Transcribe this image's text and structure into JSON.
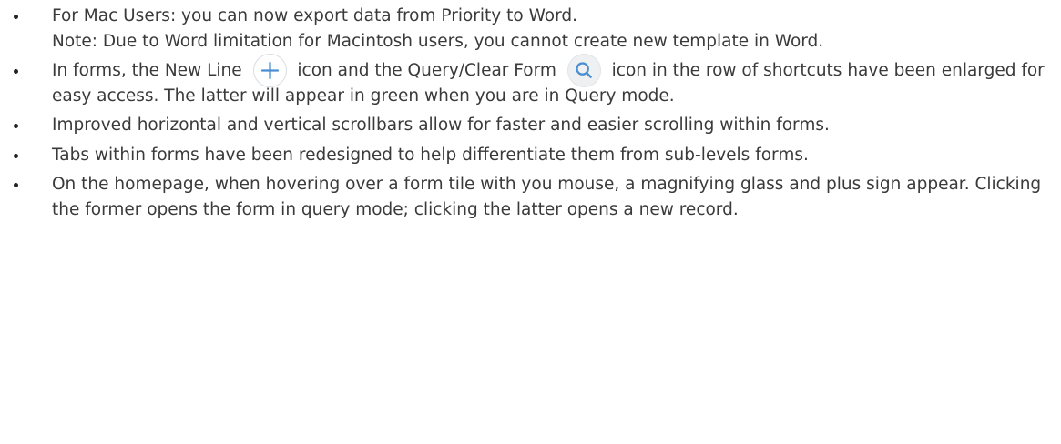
{
  "bullets": [
    {
      "text": "For Mac Users: you can now export data from Priority to Word.",
      "note": "Note: Due to Word limitation for Macintosh users, you cannot create new template in Word."
    },
    {
      "part1": "In forms, the New Line",
      "part2": "icon and the Query/Clear Form",
      "part3": "icon in the row of shortcuts have been enlarged for easy access. The latter will appear in green when you are in Query mode.",
      "icons": {
        "new_line": "plus-icon",
        "query": "magnifier-icon"
      }
    },
    {
      "text": "Improved horizontal and vertical scrollbars allow for faster and easier scrolling within forms."
    },
    {
      "text": "Tabs within forms have been redesigned to help differentiate them from sub-levels forms."
    },
    {
      "text": "On the homepage, when hovering over a form tile with you mouse, a magnifying glass and plus sign appear. Clicking the former opens the form in query mode; clicking the latter opens a new record."
    }
  ],
  "colors": {
    "text": "#3a3a3a",
    "icon_blue": "#4a8fd1",
    "icon_border": "#d8dde2"
  }
}
